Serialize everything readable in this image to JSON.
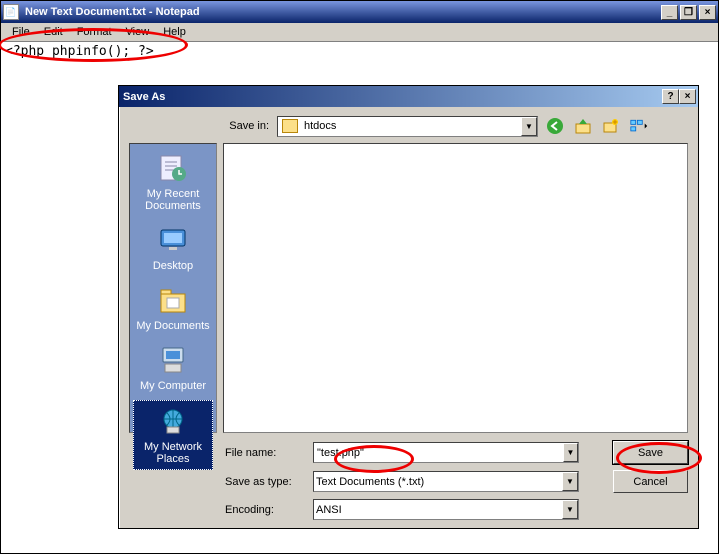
{
  "notepad": {
    "title": "New Text Document.txt - Notepad",
    "menus": [
      "File",
      "Edit",
      "Format",
      "View",
      "Help"
    ],
    "content": "<?php phpinfo(); ?>"
  },
  "dialog": {
    "title": "Save As",
    "help": "?",
    "close": "×",
    "savein_label": "Save in:",
    "savein_value": "htdocs",
    "places": [
      {
        "label": "My Recent Documents"
      },
      {
        "label": "Desktop"
      },
      {
        "label": "My Documents"
      },
      {
        "label": "My Computer"
      },
      {
        "label": "My Network Places"
      }
    ],
    "filename_label": "File name:",
    "filename_value": "\"test.php\"",
    "type_label": "Save as type:",
    "type_value": "Text Documents (*.txt)",
    "encoding_label": "Encoding:",
    "encoding_value": "ANSI",
    "save_btn": "Save",
    "cancel_btn": "Cancel"
  },
  "winbtns": {
    "min": "_",
    "max": "□",
    "restore": "❐",
    "close": "×"
  }
}
